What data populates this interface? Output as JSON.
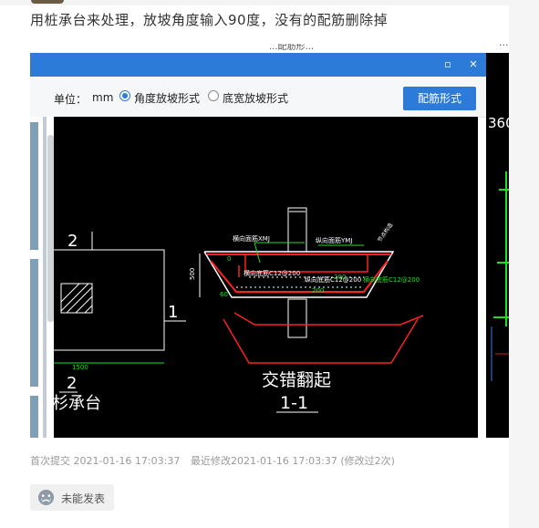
{
  "question": "用桩承台来处理，放坡角度输入90度，没有的配筋删除掉",
  "background": {
    "top_label": "...配筋形...",
    "top_right": "..."
  },
  "dialog": {
    "maximize_glyph": "▫",
    "close_glyph": "✕",
    "unit_label": "单位：",
    "unit_value": "mm",
    "radio_angle": "角度放坡形式",
    "radio_width": "底宽放坡形式",
    "reinforcement_button": "配筋形式"
  },
  "drawing": {
    "plan_mark_top": "2",
    "plan_mark_bottom": "2",
    "plan_mark_right": "1",
    "plan_dim": "1500",
    "plan_caption": "杉承台",
    "label_horizontal_top": "横向面筋XMJ",
    "label_longitudinal_top": "纵向面筋YMJ",
    "label_horizontal_bottom": "横向底筋C12@200",
    "label_longitudinal_bottom": "纵向底筋C12@200",
    "dim_height": "500",
    "dim_angle": "60",
    "dim_small": "0",
    "dim_small_2": "200",
    "edge_note": "节点构造",
    "section_title": "交错翻起",
    "section_label": "1-1",
    "side_number": "360"
  },
  "meta": {
    "first_submit": "首次提交 2021-01-16 17:03:37",
    "last_modified": "最近修改2021-01-16 17:03:37 (修改过2次)"
  },
  "actions": {
    "unable_label": "未能发表"
  },
  "colors": {
    "title_bar": "#2d7bd8",
    "cad_red": "#ff2020",
    "cad_green": "#22dd22",
    "cad_white": "#ffffff"
  }
}
